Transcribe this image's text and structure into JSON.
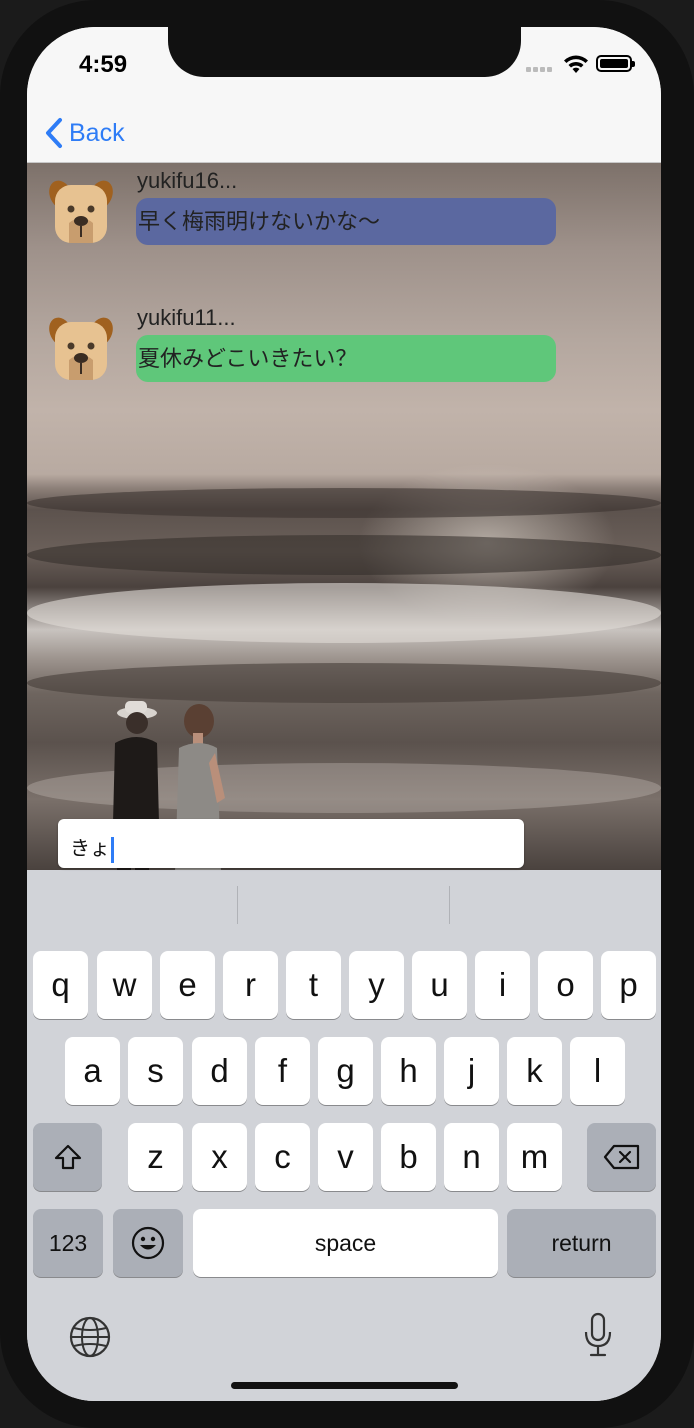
{
  "status_bar": {
    "time": "4:59"
  },
  "nav": {
    "back_label": "Back"
  },
  "messages": [
    {
      "sender": "yukifu16...",
      "text": "早く梅雨明けないかな〜",
      "bubble_color": "#5b68a0"
    },
    {
      "sender": "yukifu11...",
      "text": "夏休みどこいきたい？",
      "bubble_color": "#5fc77a"
    }
  ],
  "input": {
    "value": "きょ"
  },
  "keyboard": {
    "row1": [
      "q",
      "w",
      "e",
      "r",
      "t",
      "y",
      "u",
      "i",
      "o",
      "p"
    ],
    "row2": [
      "a",
      "s",
      "d",
      "f",
      "g",
      "h",
      "j",
      "k",
      "l"
    ],
    "row3": [
      "z",
      "x",
      "c",
      "v",
      "b",
      "n",
      "m"
    ],
    "numbers_label": "123",
    "space_label": "space",
    "return_label": "return"
  },
  "colors": {
    "accent": "#2e7cf6",
    "keyboard_bg": "#d1d3d8"
  }
}
